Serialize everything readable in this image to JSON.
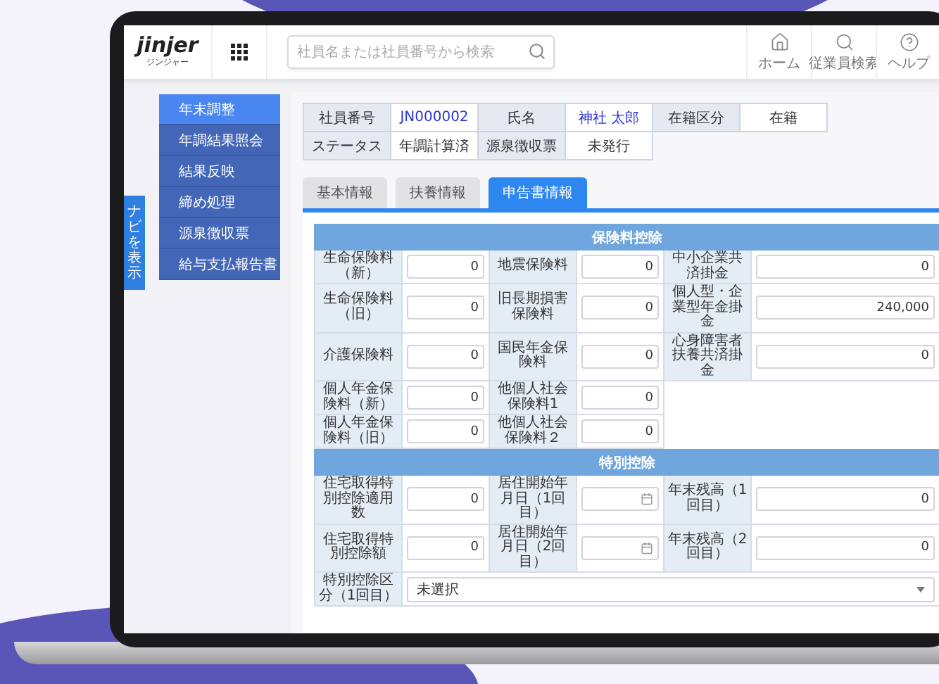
{
  "header": {
    "logo": "jinjer",
    "logo_sub": "ジンジャー",
    "search": {
      "placeholder": "社員名または社員番号から検索"
    },
    "nav_icons": [
      {
        "kind": "home",
        "label": "ホーム"
      },
      {
        "kind": "search",
        "label": "従業員検索"
      },
      {
        "kind": "help",
        "label": "ヘルプ"
      }
    ]
  },
  "nav_toggle": "ナビを表示",
  "sidebar": {
    "items": [
      {
        "label": "年末調整",
        "selected": true
      },
      {
        "label": "年調結果照会",
        "selected": false
      },
      {
        "label": "結果反映",
        "selected": false
      },
      {
        "label": "締め処理",
        "selected": false
      },
      {
        "label": "源泉徴収票",
        "selected": false
      },
      {
        "label": "給与支払報告書",
        "selected": false
      }
    ]
  },
  "employee_info": [
    {
      "label": "社員番号",
      "value": "JN000002",
      "link": true
    },
    {
      "label": "氏名",
      "value": "神社 太郎",
      "link": true
    },
    {
      "label": "在籍区分",
      "value": "在籍",
      "link": false
    },
    {
      "label": "ステータス",
      "value": "年調計算済",
      "link": false
    },
    {
      "label": "源泉徴収票",
      "value": "未発行",
      "link": false
    }
  ],
  "tabs": [
    {
      "label": "基本情報",
      "selected": false
    },
    {
      "label": "扶養情報",
      "selected": false
    },
    {
      "label": "申告書情報",
      "selected": true
    }
  ],
  "sections": [
    {
      "title": "保険料控除",
      "rows": [
        [
          {
            "label": "生命保険料（新）",
            "kind": "number",
            "value": "0"
          },
          {
            "label": "地震保険料",
            "kind": "number",
            "value": "0"
          },
          {
            "label": "中小企業共済掛金",
            "kind": "number",
            "value": "0"
          }
        ],
        [
          {
            "label": "生命保険料（旧）",
            "kind": "number",
            "value": "0"
          },
          {
            "label": "旧長期損害保険料",
            "kind": "number",
            "value": "0"
          },
          {
            "label": "個人型・企業型年金掛金",
            "kind": "number",
            "value": "240,000"
          }
        ],
        [
          {
            "label": "介護保険料",
            "kind": "number",
            "value": "0"
          },
          {
            "label": "国民年金保険料",
            "kind": "number",
            "value": "0"
          },
          {
            "label": "心身障害者扶養共済掛金",
            "kind": "number",
            "value": "0"
          }
        ],
        [
          {
            "label": "個人年金保険料（新）",
            "kind": "number",
            "value": "0"
          },
          {
            "label": "他個人社会保険料1",
            "kind": "number",
            "value": "0"
          }
        ],
        [
          {
            "label": "個人年金保険料（旧）",
            "kind": "number",
            "value": "0"
          },
          {
            "label": "他個人社会保険料２",
            "kind": "number",
            "value": "0"
          }
        ]
      ]
    },
    {
      "title": "特別控除",
      "rows": [
        [
          {
            "label": "住宅取得特別控除適用数",
            "kind": "number",
            "value": "0"
          },
          {
            "label": "居住開始年月日（1回目）",
            "kind": "date"
          },
          {
            "label": "年末残高（1回目）",
            "kind": "number",
            "value": "0"
          }
        ],
        [
          {
            "label": "住宅取得特別控除額",
            "kind": "number",
            "value": "0"
          },
          {
            "label": "居住開始年月日（2回目）",
            "kind": "date"
          },
          {
            "label": "年末残高（2回目）",
            "kind": "number",
            "value": "0"
          }
        ],
        [
          {
            "label": "特別控除区分（1回目）",
            "kind": "select",
            "value": "未選択"
          }
        ]
      ]
    }
  ]
}
